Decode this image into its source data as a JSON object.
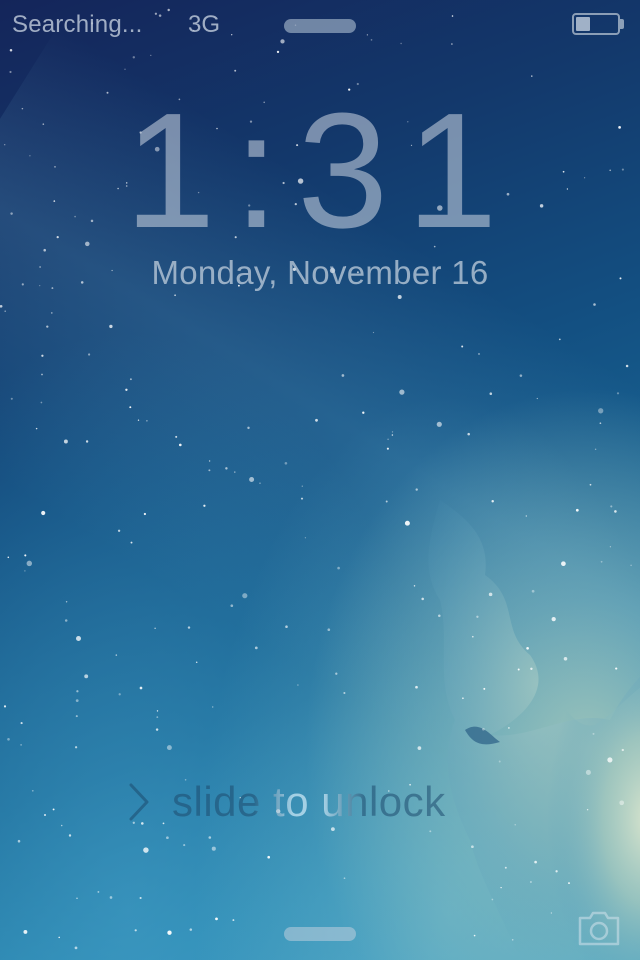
{
  "status_bar": {
    "carrier": "Searching...",
    "network": "3G",
    "battery_level": 0.35,
    "battery_icon": "battery-icon"
  },
  "lock_screen": {
    "time": "1:31",
    "date": "Monday, November 16",
    "slide_label": "slide to unlock",
    "chevron_icon": "chevron-right-icon",
    "camera_icon": "camera-icon"
  },
  "colors": {
    "sky_top": "#14255a",
    "sky_mid": "#135082",
    "sky_bottom": "#3c9cc2",
    "nebula": "#afcdb9"
  }
}
